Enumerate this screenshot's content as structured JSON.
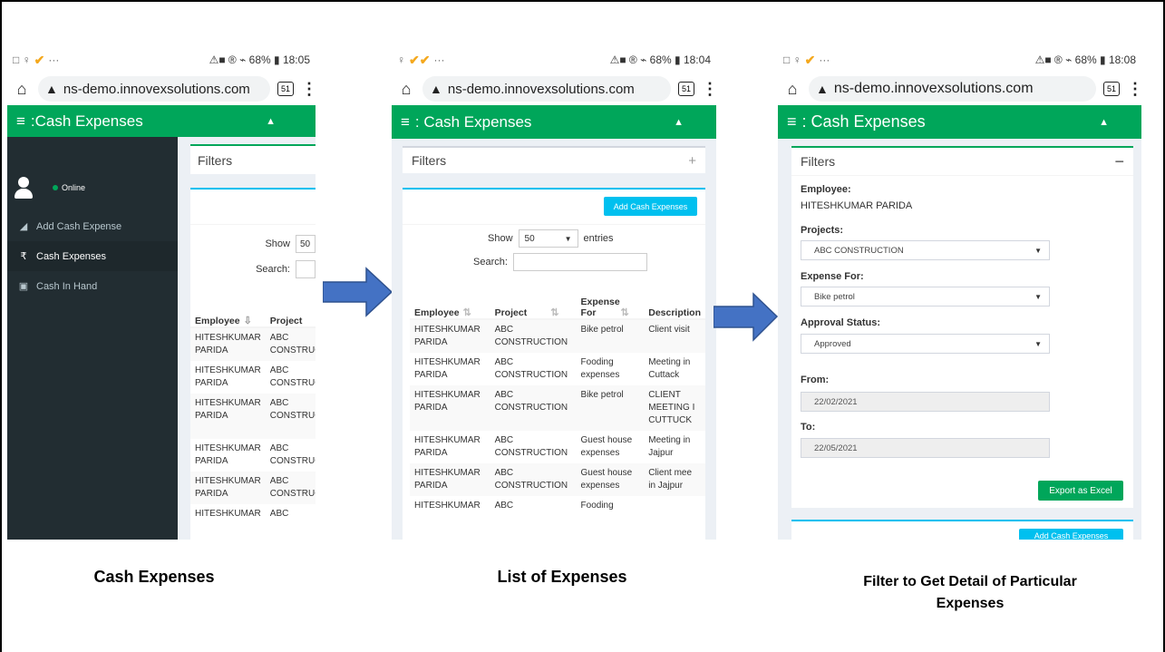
{
  "phones": {
    "p1": {
      "status_left": "□ ♀",
      "status_right": "⚠■ ® ⌁ 68% ▮ 18:05",
      "dots": "···"
    },
    "p2": {
      "status_left": "♀",
      "status_right": "⚠■ ® ⌁ 68% ▮ 18:04",
      "dots": "···"
    },
    "p3": {
      "status_left": "□ ♀",
      "status_right": "⚠■ ® ⌁ 68% ▮ 18:08",
      "dots": "···"
    }
  },
  "browser": {
    "url": "ns-demo.innovexsolutions.com",
    "tab_count": "51"
  },
  "appbar": {
    "title": ": Cash Expenses",
    "title_p1": ":Cash Expenses"
  },
  "sidebar": {
    "status": "Online",
    "items": [
      {
        "label": "Add Cash Expense",
        "icon": "paper-plane-icon"
      },
      {
        "label": "Cash Expenses",
        "icon": "rupee-icon"
      },
      {
        "label": "Cash In Hand",
        "icon": "money-icon"
      }
    ]
  },
  "filters": {
    "title": "Filters"
  },
  "list": {
    "show_label": "Show",
    "show_value": "50",
    "entries_label": "entries",
    "search_label": "Search:",
    "add_button": "Add Cash Expenses",
    "columns": [
      "Employee",
      "Project",
      "Expense For",
      "Description"
    ],
    "p1_columns": [
      "Employee",
      "Project"
    ],
    "rows": [
      {
        "employee": "HITESHKUMAR PARIDA",
        "project": "ABC CONSTRUCTION",
        "expense_for": "Bike petrol",
        "description": "Client visit"
      },
      {
        "employee": "HITESHKUMAR PARIDA",
        "project": "ABC CONSTRUCTION",
        "expense_for": "Fooding expenses",
        "description": "Meeting in Cuttack"
      },
      {
        "employee": "HITESHKUMAR PARIDA",
        "project": "ABC CONSTRUCTION",
        "expense_for": "Bike petrol",
        "description": "CLIENT MEETING I CUTTUCK"
      },
      {
        "employee": "HITESHKUMAR PARIDA",
        "project": "ABC CONSTRUCTION",
        "expense_for": "Guest house expenses",
        "description": "Meeting in Jajpur"
      },
      {
        "employee": "HITESHKUMAR PARIDA",
        "project": "ABC CONSTRUCTION",
        "expense_for": "Guest house expenses",
        "description": "Client mee in Jajpur"
      },
      {
        "employee": "HITESHKUMAR",
        "project": "ABC",
        "expense_for": "Fooding",
        "description": ""
      }
    ]
  },
  "filter_form": {
    "employee_label": "Employee:",
    "employee_value": "HITESHKUMAR PARIDA",
    "projects_label": "Projects:",
    "projects_value": "ABC CONSTRUCTION",
    "expense_for_label": "Expense For:",
    "expense_for_value": "Bike petrol",
    "approval_label": "Approval Status:",
    "approval_value": "Approved",
    "from_label": "From:",
    "from_value": "22/02/2021",
    "to_label": "To:",
    "to_value": "22/05/2021",
    "export_button": "Export as Excel",
    "add_button": "Add Cash Expenses"
  },
  "captions": {
    "c1": "Cash Expenses",
    "c2": "List of Expenses",
    "c3_line1": "Filter to Get Detail of Particular",
    "c3_line2": "Expenses"
  },
  "colors": {
    "header_green": "#00a65a",
    "sidebar_dark": "#222d32",
    "info_blue": "#00c0ef",
    "arrow_blue": "#4472c4"
  }
}
